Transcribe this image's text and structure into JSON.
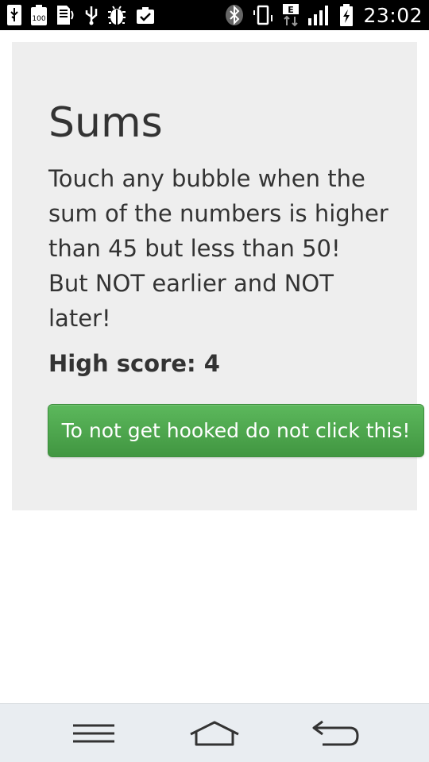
{
  "status_bar": {
    "time": "23:02",
    "network_type": "E",
    "left_icons": [
      "usb-icon",
      "battery-100-icon",
      "sd-card-icon",
      "usb-debug-icon",
      "bug-icon",
      "clipboard-check-icon"
    ],
    "right_icons": [
      "bluetooth-icon",
      "vibrate-icon",
      "data-arrows-icon",
      "signal-icon",
      "battery-charging-icon"
    ]
  },
  "game": {
    "title": "Sums",
    "instructions": [
      "Touch any bubble when the",
      "sum of the numbers is higher",
      "than 45 but less than 50!",
      "But NOT earlier and NOT",
      "later!"
    ],
    "high_score_label": "High score: 4",
    "hook_button_label": "To not get hooked do not click this!",
    "button_color": "#5cb85c"
  },
  "nav_bar": {
    "buttons": [
      "menu-icon",
      "home-icon",
      "back-icon"
    ]
  }
}
